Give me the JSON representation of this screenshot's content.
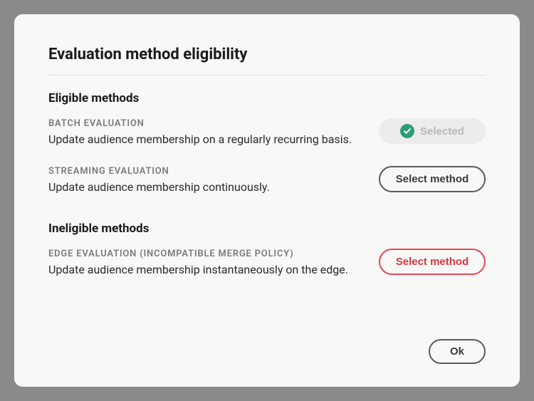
{
  "dialog": {
    "title": "Evaluation method eligibility",
    "eligible_header": "Eligible methods",
    "ineligible_header": "Ineligible methods",
    "ok_label": "Ok"
  },
  "methods": {
    "batch": {
      "label": "BATCH EVALUATION",
      "desc": "Update audience membership on a regularly recurring basis.",
      "button": "Selected"
    },
    "streaming": {
      "label": "STREAMING EVALUATION",
      "desc": "Update audience membership continuously.",
      "button": "Select method"
    },
    "edge": {
      "label": "EDGE EVALUATION (INCOMPATIBLE MERGE POLICY)",
      "desc": "Update audience membership instantaneously on the edge.",
      "button": "Select method"
    }
  }
}
